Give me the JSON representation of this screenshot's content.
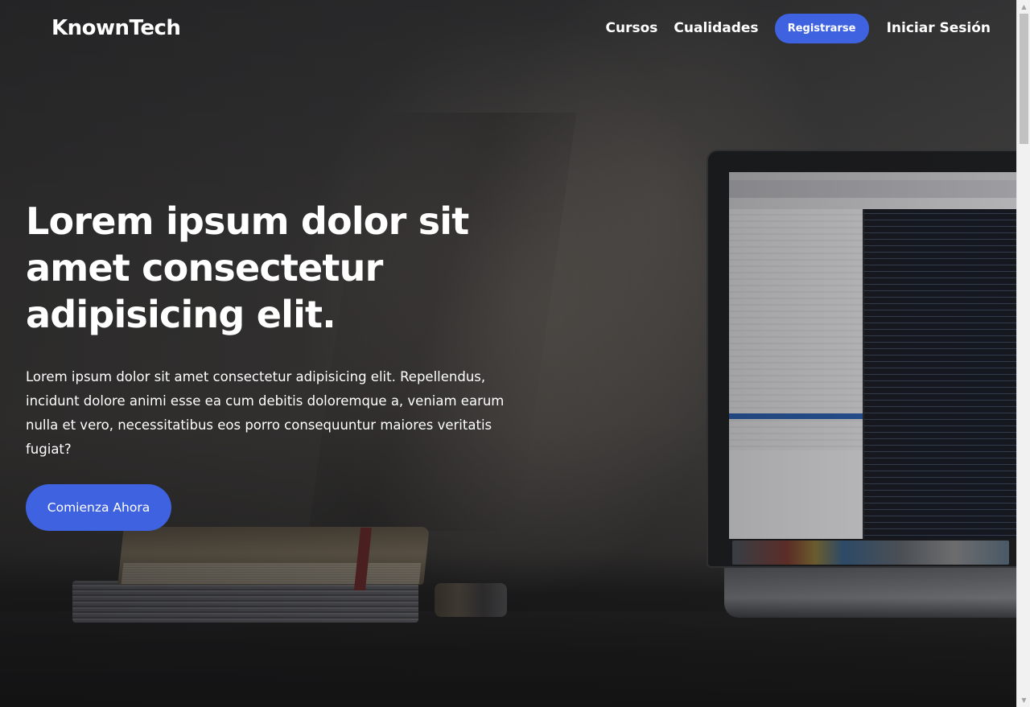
{
  "navbar": {
    "brand": "KnownTech",
    "links": {
      "courses": "Cursos",
      "features": "Cualidades",
      "register": "Registrarse",
      "login": "Iniciar Sesión"
    }
  },
  "hero": {
    "title": "Lorem ipsum dolor sit amet consectetur adipisicing elit.",
    "text": "Lorem ipsum dolor sit amet consectetur adipisicing elit. Repellendus, incidunt dolore animi esse ea cum debitis doloremque a, veniam earum nulla et vero, necessitatibus eos porro consequuntur maiores veritatis fugiat?",
    "cta": "Comienza Ahora"
  },
  "colors": {
    "accent": "#3f63e0",
    "text": "#ffffff",
    "background": "#2b2b2c"
  },
  "background_image": "desk-with-laptop-and-books-photo",
  "icons": {
    "scroll_up": "triangle-up-icon",
    "scroll_down": "triangle-down-icon"
  },
  "scrollbar": {
    "up_glyph": "▲",
    "down_glyph": "▼"
  }
}
